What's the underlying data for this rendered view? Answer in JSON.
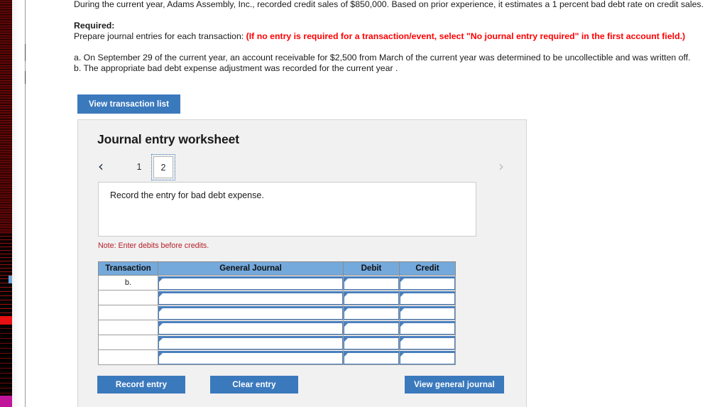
{
  "problem": {
    "intro": "During the current year, Adams Assembly, Inc., recorded credit sales of $850,000. Based on prior experience, it estimates a 1 percent bad debt rate on credit sales.",
    "required_label": "Required:",
    "required_lead": "Prepare journal entries for each transaction:",
    "required_note": "(If no entry is required for a transaction/event, select \"No journal entry required\" in the first account field.)",
    "item_a": "a. On September 29 of the current year, an account receivable for  $2,500 from March of the current year was determined to be uncollectible and was written off.",
    "item_b": "b. The appropriate bad debt expense adjustment was recorded for the current year ."
  },
  "toolbar": {
    "view_transaction_list_label": "View transaction list"
  },
  "worksheet": {
    "title": "Journal entry worksheet",
    "pager": {
      "prev_icon": "‹",
      "next_icon": "›",
      "pages": [
        "1",
        "2"
      ],
      "selected_page": "2"
    },
    "prompt": "Record the entry for bad debt expense.",
    "note": "Note: Enter debits before credits.",
    "table": {
      "headers": [
        "Transaction",
        "General Journal",
        "Debit",
        "Credit"
      ],
      "rows": [
        {
          "transaction": "b.",
          "general_journal": "",
          "debit": "",
          "credit": ""
        },
        {
          "transaction": "",
          "general_journal": "",
          "debit": "",
          "credit": ""
        },
        {
          "transaction": "",
          "general_journal": "",
          "debit": "",
          "credit": ""
        },
        {
          "transaction": "",
          "general_journal": "",
          "debit": "",
          "credit": ""
        },
        {
          "transaction": "",
          "general_journal": "",
          "debit": "",
          "credit": ""
        },
        {
          "transaction": "",
          "general_journal": "",
          "debit": "",
          "credit": ""
        }
      ]
    },
    "actions": {
      "record_entry_label": "Record entry",
      "clear_entry_label": "Clear entry",
      "view_general_journal_label": "View general journal"
    }
  },
  "colors": {
    "button_blue": "#3b79bd",
    "table_header_blue": "#74a9dc",
    "input_border_blue": "#4a7fbd",
    "note_red": "#b5202b",
    "required_red": "#ff0000",
    "card_bg": "#f1f1f1"
  }
}
